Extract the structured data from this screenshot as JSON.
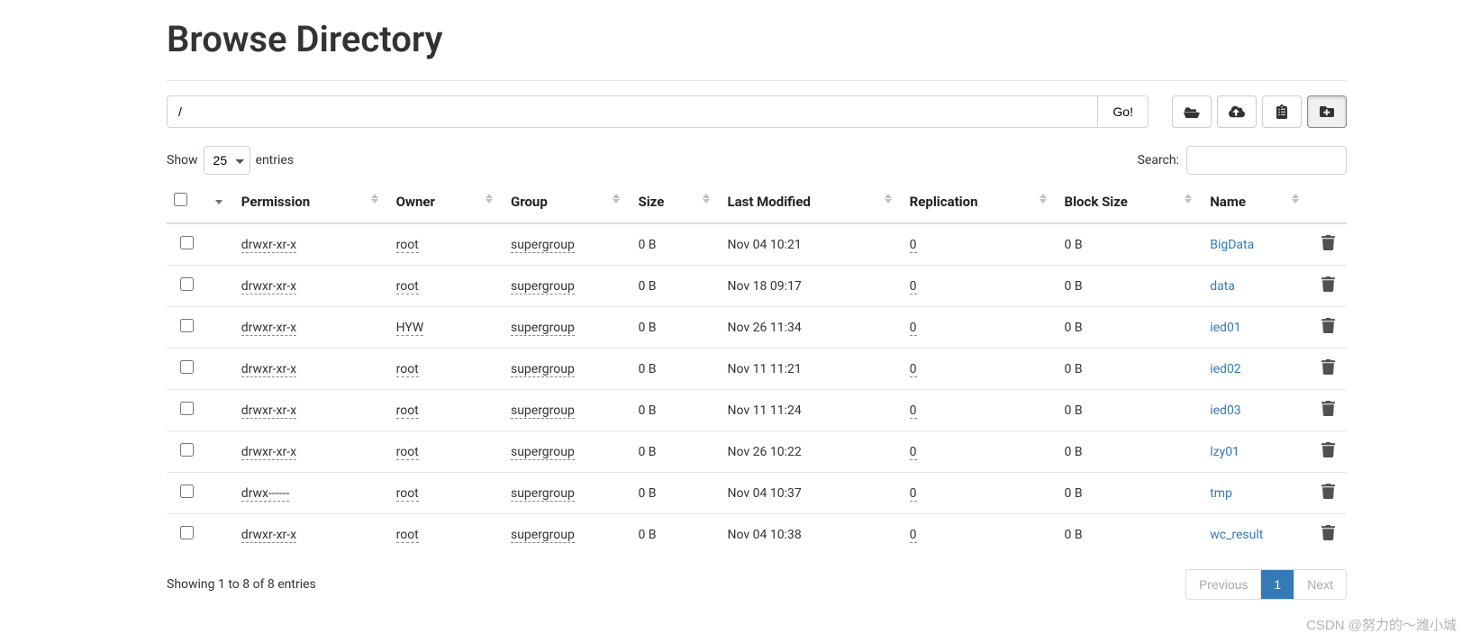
{
  "title": "Browse Directory",
  "path": {
    "value": "/",
    "go_label": "Go!"
  },
  "toolbar": {
    "open_folder": "open-folder",
    "upload": "upload",
    "cut": "snippet",
    "new_folder": "new-folder"
  },
  "show_entries": {
    "prefix": "Show",
    "selected": "25",
    "suffix": "entries"
  },
  "search": {
    "label": "Search:",
    "value": ""
  },
  "columns": {
    "permission": "Permission",
    "owner": "Owner",
    "group": "Group",
    "size": "Size",
    "last_modified": "Last Modified",
    "replication": "Replication",
    "block_size": "Block Size",
    "name": "Name"
  },
  "rows": [
    {
      "permission": "drwxr-xr-x",
      "owner": "root",
      "group": "supergroup",
      "size": "0 B",
      "modified": "Nov 04 10:21",
      "replication": "0",
      "block": "0 B",
      "name": "BigData"
    },
    {
      "permission": "drwxr-xr-x",
      "owner": "root",
      "group": "supergroup",
      "size": "0 B",
      "modified": "Nov 18 09:17",
      "replication": "0",
      "block": "0 B",
      "name": "data"
    },
    {
      "permission": "drwxr-xr-x",
      "owner": "HYW",
      "group": "supergroup",
      "size": "0 B",
      "modified": "Nov 26 11:34",
      "replication": "0",
      "block": "0 B",
      "name": "ied01"
    },
    {
      "permission": "drwxr-xr-x",
      "owner": "root",
      "group": "supergroup",
      "size": "0 B",
      "modified": "Nov 11 11:21",
      "replication": "0",
      "block": "0 B",
      "name": "ied02"
    },
    {
      "permission": "drwxr-xr-x",
      "owner": "root",
      "group": "supergroup",
      "size": "0 B",
      "modified": "Nov 11 11:24",
      "replication": "0",
      "block": "0 B",
      "name": "ied03"
    },
    {
      "permission": "drwxr-xr-x",
      "owner": "root",
      "group": "supergroup",
      "size": "0 B",
      "modified": "Nov 26 10:22",
      "replication": "0",
      "block": "0 B",
      "name": "lzy01"
    },
    {
      "permission": "drwx------",
      "owner": "root",
      "group": "supergroup",
      "size": "0 B",
      "modified": "Nov 04 10:37",
      "replication": "0",
      "block": "0 B",
      "name": "tmp"
    },
    {
      "permission": "drwxr-xr-x",
      "owner": "root",
      "group": "supergroup",
      "size": "0 B",
      "modified": "Nov 04 10:38",
      "replication": "0",
      "block": "0 B",
      "name": "wc_result"
    }
  ],
  "footer": {
    "info": "Showing 1 to 8 of 8 entries",
    "prev": "Previous",
    "page": "1",
    "next": "Next"
  },
  "watermark": "CSDN @努力的～潍小城"
}
